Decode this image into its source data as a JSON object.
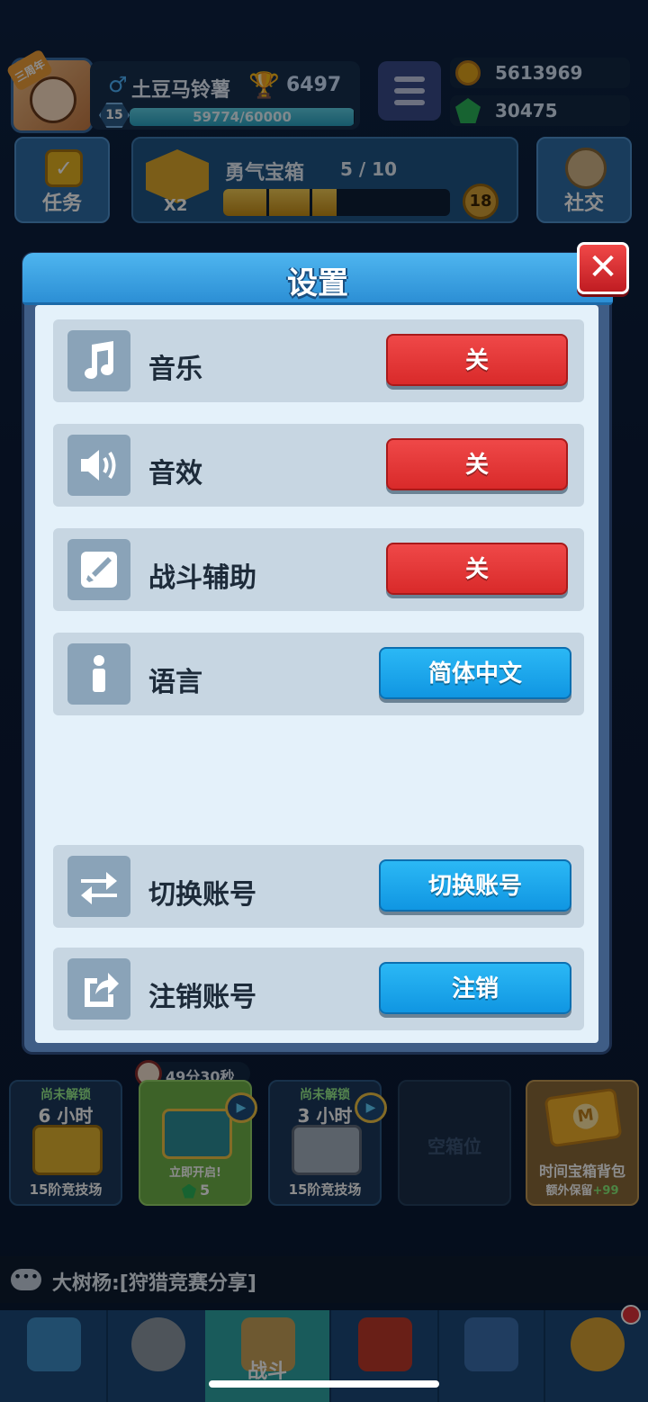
{
  "colors": {
    "accent_blue": "#1096e2",
    "off_red": "#d92a2a",
    "header_blue": "#2c8fd5",
    "panel_bg": "#e4f1fa",
    "row_bg": "#c7d6e2"
  },
  "top": {
    "avatar_badge": "三周年",
    "player_name": "土豆马铃薯",
    "trophies": "6497",
    "level": "15",
    "xp_text": "59774/60000",
    "xp_fraction": 0.996,
    "gold": "5613969",
    "gems": "30475"
  },
  "row2": {
    "task_label": "任务",
    "chest_title": "勇气宝箱",
    "chest_count": "5 / 10",
    "chest_fraction": 0.5,
    "multiplier": "X2",
    "timer_value": "18",
    "social_label": "社交"
  },
  "modal": {
    "title": "设置",
    "close_glyph": "✕",
    "rows": [
      {
        "label": "音乐",
        "button": "关",
        "icon": "music-note-icon"
      },
      {
        "label": "音效",
        "button": "关",
        "icon": "speaker-icon"
      },
      {
        "label": "战斗辅助",
        "button": "关",
        "icon": "sword-icon"
      },
      {
        "label": "语言",
        "button": "简体中文",
        "icon": "info-icon"
      },
      {
        "label": "切换账号",
        "button": "切换账号",
        "icon": "swap-arrows-icon"
      },
      {
        "label": "注销账号",
        "button": "注销",
        "icon": "share-export-icon"
      }
    ]
  },
  "slots": {
    "open_timer": "49分30秒",
    "items": [
      {
        "top": "尚未解锁",
        "time": "6 小时",
        "bottom": "15阶竞技场"
      },
      {
        "label": "立即开启!",
        "gem_cost": "5"
      },
      {
        "top": "尚未解锁",
        "time": "3 小时",
        "bottom": "15阶竞技场"
      },
      {
        "label": "空箱位"
      },
      {
        "title": "时间宝箱背包",
        "sub_prefix": "额外保留",
        "sub_value": "+99",
        "card_letter": "M"
      }
    ]
  },
  "chat": {
    "message": "大树杨:[狩猎竞赛分享]"
  },
  "nav": {
    "active_label": "战斗"
  }
}
